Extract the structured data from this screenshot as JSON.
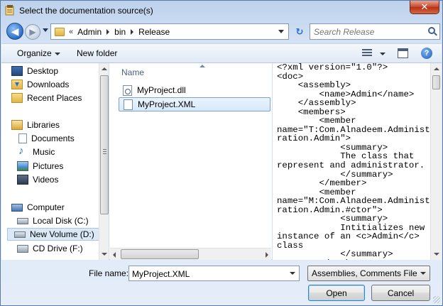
{
  "window": {
    "title": "Select the documentation source(s)",
    "close_label": "✕"
  },
  "address": {
    "prefix": "«",
    "crumbs": [
      "Admin",
      "bin",
      "Release"
    ],
    "search_placeholder": "Search Release"
  },
  "toolbar": {
    "organize_label": "Organize",
    "new_folder_label": "New folder",
    "help_label": "?"
  },
  "navigation": {
    "items": [
      {
        "label": "Desktop",
        "icon": "desktop-icon"
      },
      {
        "label": "Downloads",
        "icon": "downloads-icon"
      },
      {
        "label": "Recent Places",
        "icon": "recent-places-icon"
      },
      {
        "label": "Libraries",
        "icon": "libraries-icon"
      },
      {
        "label": "Documents",
        "icon": "documents-icon"
      },
      {
        "label": "Music",
        "icon": "music-icon"
      },
      {
        "label": "Pictures",
        "icon": "pictures-icon"
      },
      {
        "label": "Videos",
        "icon": "videos-icon"
      },
      {
        "label": "Computer",
        "icon": "computer-icon"
      },
      {
        "label": "Local Disk (C:)",
        "icon": "local-disk-icon"
      },
      {
        "label": "New Volume (D:)",
        "icon": "volume-icon",
        "selected": true
      },
      {
        "label": "CD Drive (F:)",
        "icon": "cd-drive-icon"
      }
    ]
  },
  "file_list": {
    "column_name": "Name",
    "files": [
      {
        "name": "MyProject.dll",
        "selected": false
      },
      {
        "name": "MyProject.XML",
        "selected": true
      }
    ]
  },
  "preview": {
    "text": "<?xml version=\"1.0\"?>\n<doc>\n    <assembly>\n        <name>Admin</name>\n    </assembly>\n    <members>\n        <member\nname=\"T:Com.Alnadeem.Administ\nration.Admin\">\n            <summary>\n            The class that\nrepresent and administrator.\n            </summary>\n        </member>\n        <member\nname=\"M:Com.Alnadeem.Administ\nration.Admin.#ctor\">\n            <summary>\n            Intitializes new\ninstance of an <c>Admin</c>\nclass\n            </summary>\n        </member>"
  },
  "bottom": {
    "file_name_label": "File name:",
    "file_name_value": "MyProject.XML",
    "filter_value": "Assemblies, Comments Files, ar",
    "open_label": "Open",
    "cancel_label": "Cancel"
  },
  "colors": {
    "selection_fill": "#d6e9fc",
    "selection_border": "#7da2ce",
    "window_frame": "#bcd1ec",
    "close_red": "#c7442a"
  }
}
